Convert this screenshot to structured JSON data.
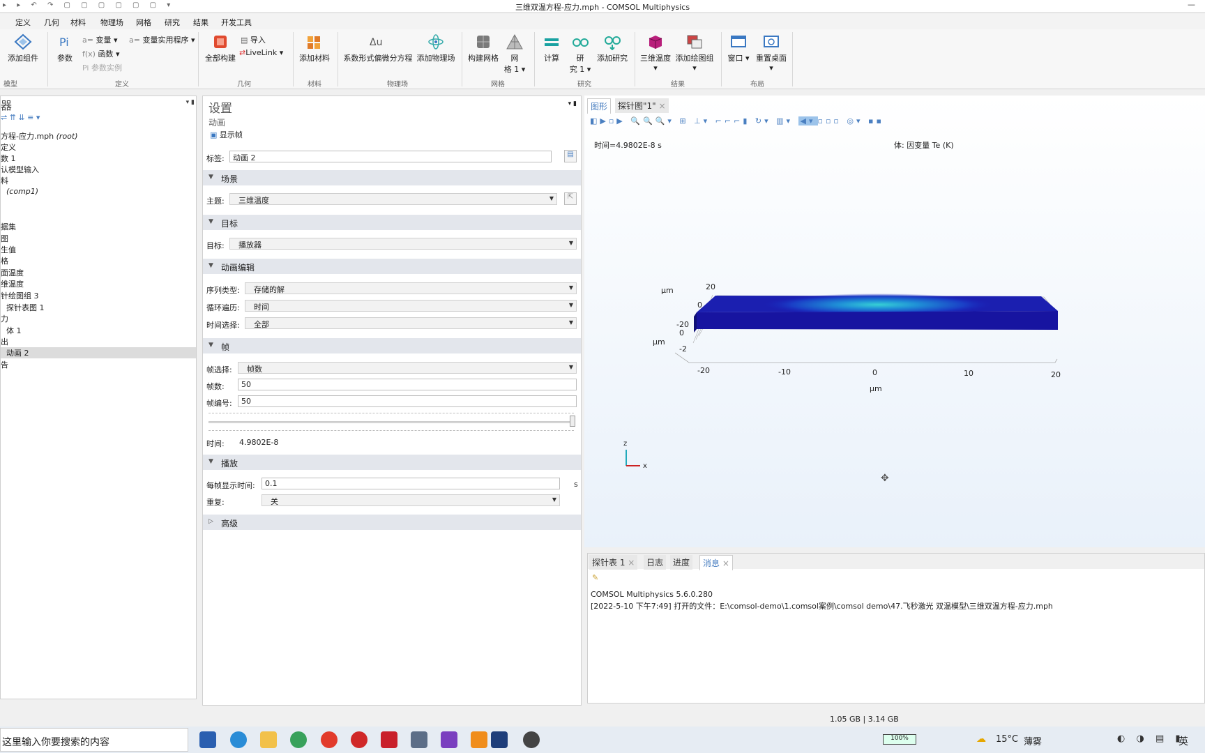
{
  "window": {
    "title": "三维双温方程-应力.mph - COMSOL Multiphysics"
  },
  "menu": [
    "定义",
    "几何",
    "材料",
    "物理场",
    "网格",
    "研究",
    "结果",
    "开发工具"
  ],
  "ribbon": {
    "add_component": "添加组件",
    "model_group": "模型",
    "parameters": "参数",
    "variables": "变量",
    "functions": "函数",
    "param_case": "参数实例",
    "var_utils": "变量实用程序",
    "def_group": "定义",
    "build_all": "全部构建",
    "import": "导入",
    "livelink": "LiveLink",
    "geom_group": "几何",
    "add_material": "添加材料",
    "mat_group": "材料",
    "pde": "系数形式偏微分方程",
    "add_physics": "添加物理场",
    "phys_group": "物理场",
    "build_mesh": "构建网格",
    "mesh1_a": "网",
    "mesh1_b": "格 1",
    "mesh_group": "网格",
    "compute": "计算",
    "study1_a": "研",
    "study1_b": "究 1",
    "add_study": "添加研究",
    "study_group": "研究",
    "temp3d": "三维温度",
    "add_plot_group": "添加绘图组",
    "results_group": "结果",
    "windows": "窗口",
    "reset_desktop": "重置桌面",
    "layout_group": "布局"
  },
  "model_builder": {
    "header": "器",
    "items": [
      "方程-应力.mph",
      "(root)",
      "定义",
      "数 1",
      "认模型输入",
      "料",
      "(comp1)",
      "据集",
      "图",
      "生值",
      "格",
      "面温度",
      "维温度",
      "针绘图组 3",
      "探针表图 1",
      "力",
      "体 1",
      "出",
      "动画 2",
      "告"
    ]
  },
  "settings": {
    "title": "设置",
    "subtitle": "动画",
    "show_frame": "显示帧",
    "label_lbl": "标签:",
    "label_val": "动画 2",
    "scene": "场景",
    "subject_lbl": "主题:",
    "subject_val": "三维温度",
    "target": "目标",
    "target_lbl": "目标:",
    "target_val": "播放器",
    "anim_edit": "动画编辑",
    "seq_lbl": "序列类型:",
    "seq_val": "存储的解",
    "loop_lbl": "循环遍历:",
    "loop_val": "时间",
    "timesel_lbl": "时间选择:",
    "timesel_val": "全部",
    "frames": "帧",
    "framesel_lbl": "帧选择:",
    "framesel_val": "帧数",
    "nframes_lbl": "帧数:",
    "nframes_val": "50",
    "frameno_lbl": "帧编号:",
    "frameno_val": "50",
    "time_lbl": "时间:",
    "time_val": "4.9802E-8",
    "play": "播放",
    "per_frame_lbl": "每帧显示时间:",
    "per_frame_val": "0.1",
    "per_frame_unit": "s",
    "repeat_lbl": "重复:",
    "repeat_val": "关",
    "advanced": "高级"
  },
  "graphics": {
    "tab1": "图形",
    "tab2": "探针图\"1\"",
    "time_text": "时间=4.9802E-8 s",
    "vol_text": "体: 因变量 Te (K)",
    "yticks": [
      "20",
      "0",
      "-20"
    ],
    "zticks": [
      "0",
      "-2"
    ],
    "xticks": [
      "-20",
      "-10",
      "0",
      "10",
      "20"
    ],
    "unit": "μm",
    "z_axis": "z",
    "x_axis": "x"
  },
  "messages": {
    "tabs": [
      "探针表 1",
      "日志",
      "进度",
      "消息"
    ],
    "line1": "COMSOL Multiphysics 5.6.0.280",
    "line2": "[2022-5-10 下午7:49] 打开的文件：E:\\comsol-demo\\1.comsol案例\\comsol demo\\47.飞秒激光 双温模型\\三维双温方程-应力.mph"
  },
  "status": {
    "memory": "1.05 GB | 3.14 GB"
  },
  "taskbar": {
    "search": "这里输入你要搜索的内容",
    "battery": "100%",
    "weather": "15°C",
    "weather_desc": "薄雾",
    "ime": "英"
  }
}
